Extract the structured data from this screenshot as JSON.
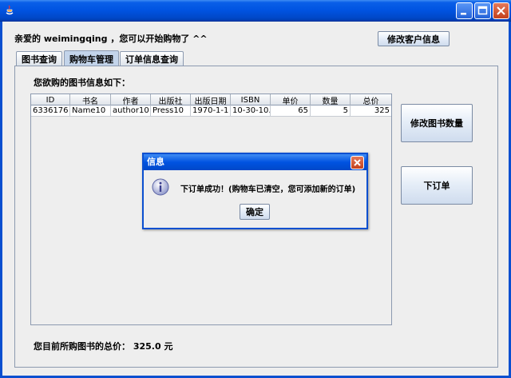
{
  "window": {
    "title": "",
    "buttons": [
      "minimize",
      "maximize",
      "close"
    ]
  },
  "header": {
    "welcome": "亲爱的 weimingqing ，您可以开始购物了 ^^",
    "modify_customer_button": "修改客户信息"
  },
  "tabs": [
    {
      "label": "图书查询",
      "selected": false
    },
    {
      "label": "购物车管理",
      "selected": true
    },
    {
      "label": "订单信息查询",
      "selected": false
    }
  ],
  "cart": {
    "caption": "您欲购的图书信息如下：",
    "columns": [
      "ID",
      "书名",
      "作者",
      "出版社",
      "出版日期",
      "ISBN",
      "单价",
      "数量",
      "总价"
    ],
    "rows": [
      [
        "6336176",
        "Name10",
        "author10",
        "Press10",
        "1970-1-1",
        "10-30-10...",
        "65",
        "5",
        "325"
      ]
    ],
    "modify_quantity_button": "修改图书数量",
    "place_order_button": "下订单",
    "total_label": "您目前所购图书的总价：  325.0 元"
  },
  "dialog": {
    "title": "信息",
    "message": "下订单成功！(购物车已清空，您可添加新的订单)",
    "ok_button": "确定"
  },
  "colors": {
    "titlebar": "#0053e1",
    "frame_bg": "#eeeeee",
    "selected_tab": "#c3d4ea"
  }
}
